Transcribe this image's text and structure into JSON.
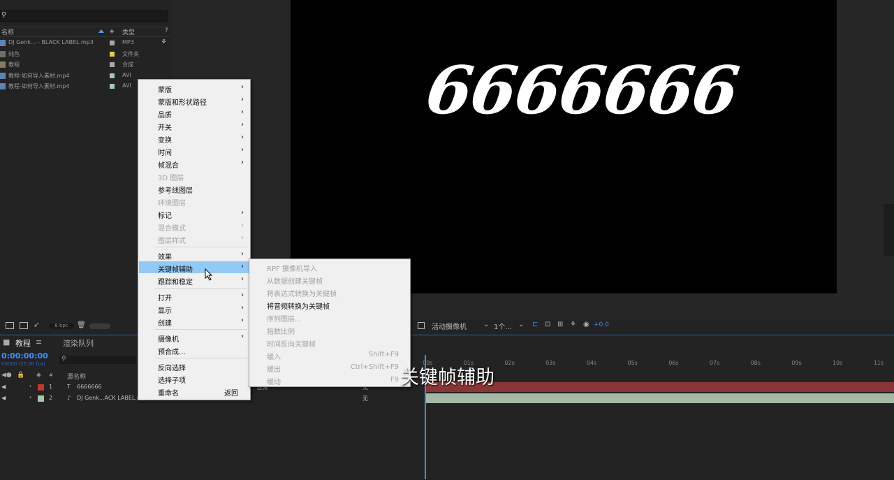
{
  "project": {
    "columns": {
      "name": "名称",
      "type": "类型"
    },
    "items": [
      {
        "name": "DJ Genk... - BLACK LABEL.mp3",
        "type": "MP3",
        "tag_color": "#a6a6a6"
      },
      {
        "name": "纯色",
        "type": "文件夹",
        "tag_color": "#e4cc4c"
      },
      {
        "name": "教程",
        "type": "合成",
        "tag_color": "#a8a8a8"
      },
      {
        "name": "教程-如何导入素材.mp4",
        "type": "AVI",
        "tag_color": "#a6c6c6"
      },
      {
        "name": "教程-如何导入素材.mp4",
        "type": "AVI",
        "tag_color": "#a6c6c6"
      }
    ],
    "footer_bpc": "8 bpc"
  },
  "viewer": {
    "comp_text": "6666666",
    "camera": "活动摄像机",
    "views": "1个...",
    "exposure": "+0.0"
  },
  "timeline": {
    "tab_active": "教程",
    "tab_render": "渲染队列",
    "timecode": "0:00:00:00",
    "fps": "00000 (25.00 fps)",
    "col_source_name": "源名称",
    "col_num": "#",
    "ruler": [
      "00s",
      "01s",
      "02s",
      "03s",
      "04s",
      "05s",
      "06s",
      "07s",
      "08s",
      "09s",
      "10s",
      "11s"
    ],
    "layers": [
      {
        "num": "1",
        "type_icon": "T",
        "name": "6666666",
        "color": "#c0392b",
        "mode": "正常",
        "trkmat": "无"
      },
      {
        "num": "2",
        "type_icon": "♪",
        "name": "DJ Genk...ACK LABEL.mp3",
        "color": "#a6c6a6",
        "mode": "",
        "trkmat": "无"
      }
    ]
  },
  "context_menu": {
    "items": [
      {
        "label": "蒙版",
        "arrow": true
      },
      {
        "label": "蒙版和形状路径",
        "arrow": true
      },
      {
        "label": "品质",
        "arrow": true
      },
      {
        "label": "开关",
        "arrow": true
      },
      {
        "label": "变换",
        "arrow": true
      },
      {
        "label": "时间",
        "arrow": true
      },
      {
        "label": "帧混合",
        "arrow": true
      },
      {
        "label": "3D 图层",
        "disabled": true
      },
      {
        "label": "参考线图层"
      },
      {
        "label": "环境图层",
        "disabled": true
      },
      {
        "label": "标记",
        "arrow": true
      },
      {
        "label": "混合模式",
        "arrow": true,
        "disabled": true
      },
      {
        "label": "图层样式",
        "arrow": true,
        "disabled": true
      },
      {
        "separator": true
      },
      {
        "label": "效果",
        "arrow": true
      },
      {
        "label": "关键帧辅助",
        "arrow": true,
        "selected": true
      },
      {
        "label": "跟踪和稳定",
        "arrow": true
      },
      {
        "separator": true
      },
      {
        "label": "打开",
        "arrow": true
      },
      {
        "label": "显示",
        "arrow": true
      },
      {
        "label": "创建",
        "arrow": true
      },
      {
        "separator": true
      },
      {
        "label": "摄像机",
        "arrow": true
      },
      {
        "label": "预合成..."
      },
      {
        "separator": true
      },
      {
        "label": "反向选择"
      },
      {
        "label": "选择子项"
      },
      {
        "label": "重命名",
        "shortcut": "返回"
      }
    ]
  },
  "submenu": {
    "items": [
      {
        "label": "RPF 摄像机导入",
        "disabled": true
      },
      {
        "label": "从数据创建关键帧",
        "disabled": true
      },
      {
        "label": "将表达式转换为关键帧",
        "disabled": true
      },
      {
        "label": "将音频转换为关键帧"
      },
      {
        "label": "序列图层...",
        "disabled": true
      },
      {
        "label": "指数比例",
        "disabled": true
      },
      {
        "label": "时间反向关键帧",
        "disabled": true
      },
      {
        "label": "缓入",
        "shortcut": "Shift+F9",
        "disabled": true
      },
      {
        "label": "缓出",
        "shortcut": "Ctrl+Shift+F9",
        "disabled": true
      },
      {
        "label": "缓动",
        "shortcut": "F9",
        "disabled": true
      }
    ]
  },
  "caption": "关键帧辅助"
}
